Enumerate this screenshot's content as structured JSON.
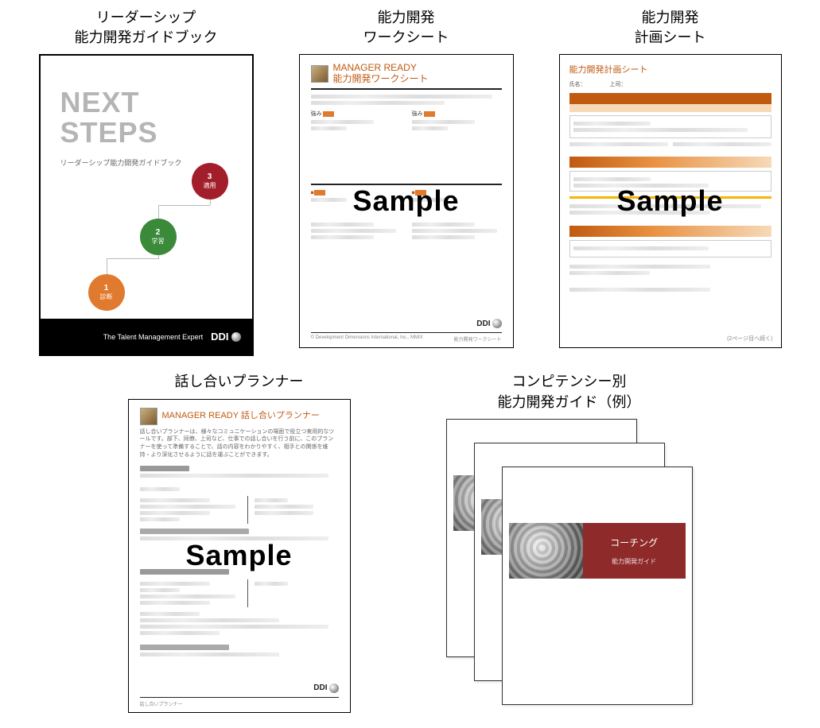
{
  "row1": {
    "card1": {
      "caption": "リーダーシップ\n能力開発ガイドブック",
      "title_line1": "NEXT",
      "title_line2": "STEPS",
      "subtitle": "リーダーシップ能力開発ガイドブック",
      "step1_n": "1",
      "step1_l": "診断",
      "step2_n": "2",
      "step2_l": "学習",
      "step3_n": "3",
      "step3_l": "適用",
      "footer_tag": "The Talent Management Expert",
      "footer_brand": "DDI"
    },
    "card2": {
      "caption": "能力開発\nワークシート",
      "header_line1": "MANAGER READY",
      "header_line2": "能力開発ワークシート",
      "sample": "Sample",
      "footer_brand": "DDI"
    },
    "card3": {
      "caption": "能力開発\n計画シート",
      "title": "能力開発計画シート",
      "meta_left": "氏名：",
      "meta_right": "上司：",
      "sample": "Sample",
      "footer_right": "(2ページ目へ続く)"
    }
  },
  "row2": {
    "card4": {
      "caption": "話し合いプランナー",
      "header_line1": "MANAGER READY 話し合いプランナー",
      "lead": "話し合いプランナーは、様々なコミュニケーションの場面で役立つ実用的なツールです。部下、同僚、上司など、仕事での話し合いを行う前に、このプランナーを使って準備することで、話の内容をわかりやすく、相手との関係を維持・より深化させるように話を運ぶことができます。",
      "sample": "Sample",
      "footer_brand": "DDI"
    },
    "card5": {
      "caption": "コンピテンシー別\n能力開発ガイド（例）",
      "cover_title": "コーチング",
      "cover_sub": "能力開発ガイド"
    }
  }
}
